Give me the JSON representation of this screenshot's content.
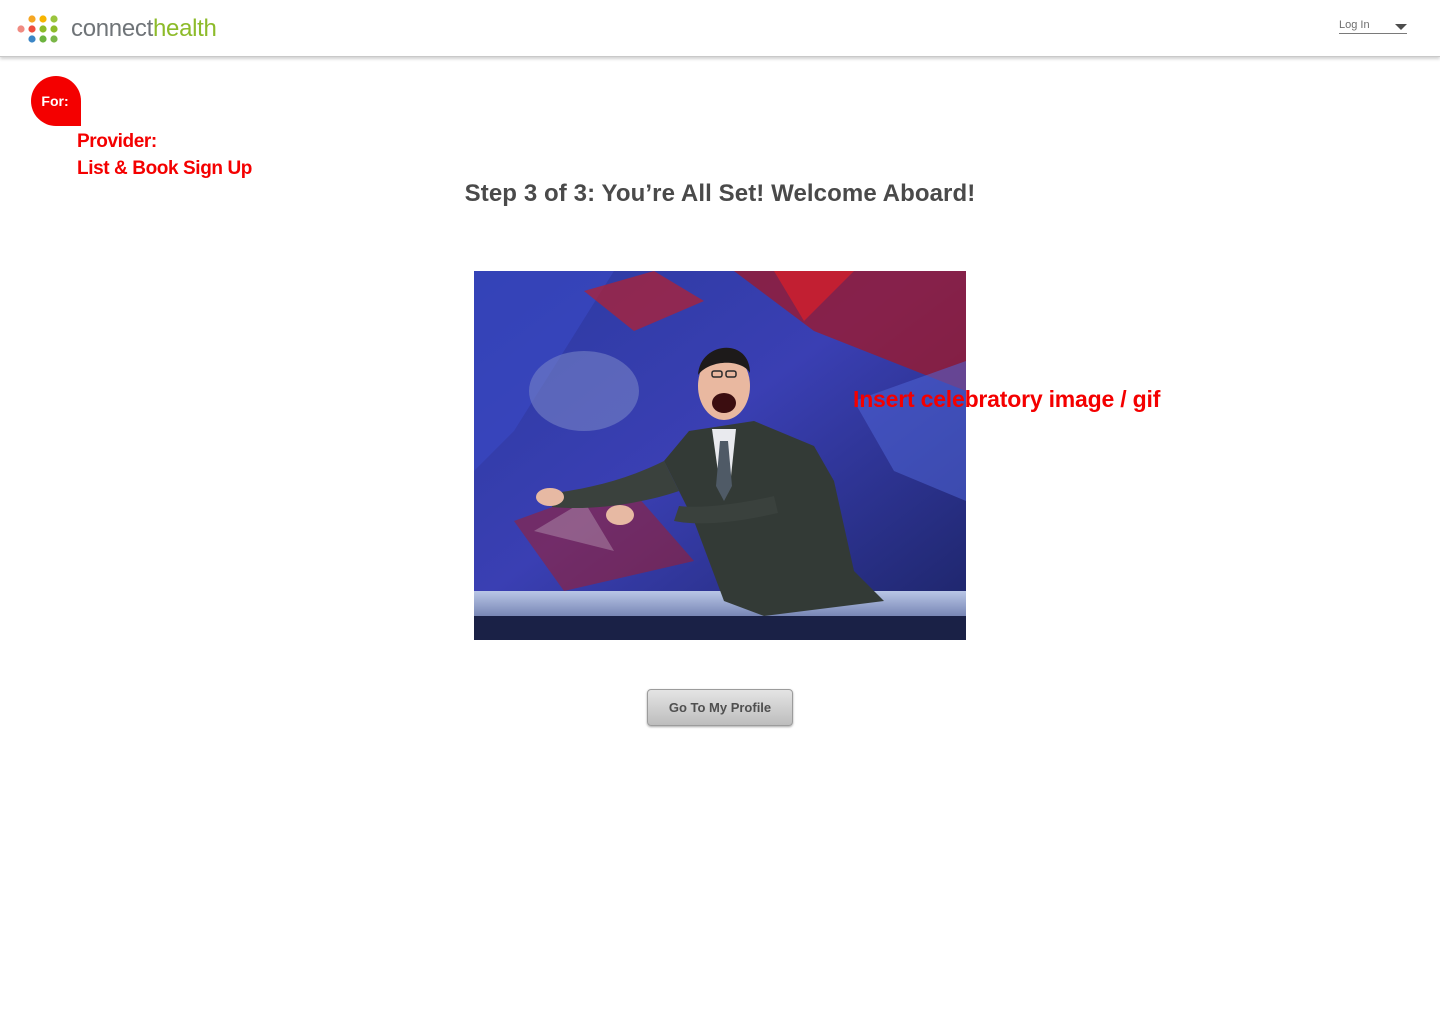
{
  "brand": {
    "name_part1": "connect",
    "name_part2": "health",
    "dot_colors": [
      "#f37b6e",
      "#f5a623",
      "#8dbb2a",
      "#f15a4a",
      "#f7b500",
      "#8dbb2a",
      "#9bc53d",
      "#3e8ed0",
      "#8dbb2a",
      "#6cb33f"
    ],
    "gray": "#6f7478",
    "green": "#8dbb2a"
  },
  "header": {
    "login_label": "Log In",
    "login_icon": "chevron-down-icon"
  },
  "context": {
    "for_label": "For:",
    "line1": "Provider:",
    "line2": "List & Book Sign Up",
    "accent_color": "#f40000"
  },
  "main": {
    "title": "Step 3 of 3:  You’re All Set!  Welcome Aboard!",
    "annotation": "Insert celebratory image / gif",
    "button_label": "Go To My Profile"
  }
}
